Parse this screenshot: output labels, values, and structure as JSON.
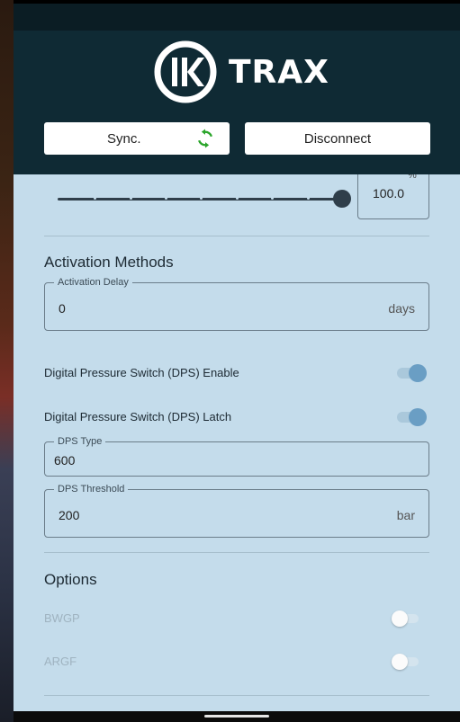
{
  "header": {
    "brand_name": "TRAX",
    "logo_mark_text": "ik",
    "sync_label": "Sync.",
    "disconnect_label": "Disconnect",
    "sync_icon": "refresh-icon",
    "sync_icon_color": "#2aa52a"
  },
  "slider": {
    "value": "100.0",
    "unit": "%",
    "fill_fraction": 1.0
  },
  "activation": {
    "title": "Activation Methods",
    "delay_label": "Activation Delay",
    "delay_value": "0",
    "delay_unit": "days",
    "dps_enable_label": "Digital Pressure Switch (DPS) Enable",
    "dps_enable_on": true,
    "dps_latch_label": "Digital Pressure Switch (DPS) Latch",
    "dps_latch_on": true,
    "dps_type_label": "DPS Type",
    "dps_type_value": "600",
    "dps_threshold_label": "DPS Threshold",
    "dps_threshold_value": "200",
    "dps_threshold_unit": "bar"
  },
  "options": {
    "title": "Options",
    "bwgp_label": "BWGP",
    "bwgp_on": false,
    "argf_label": "ARGF",
    "argf_on": false
  },
  "colors": {
    "header_bg": "#0f2a34",
    "content_bg": "#c4dceb",
    "toggle_on": "#6a9ec4"
  }
}
